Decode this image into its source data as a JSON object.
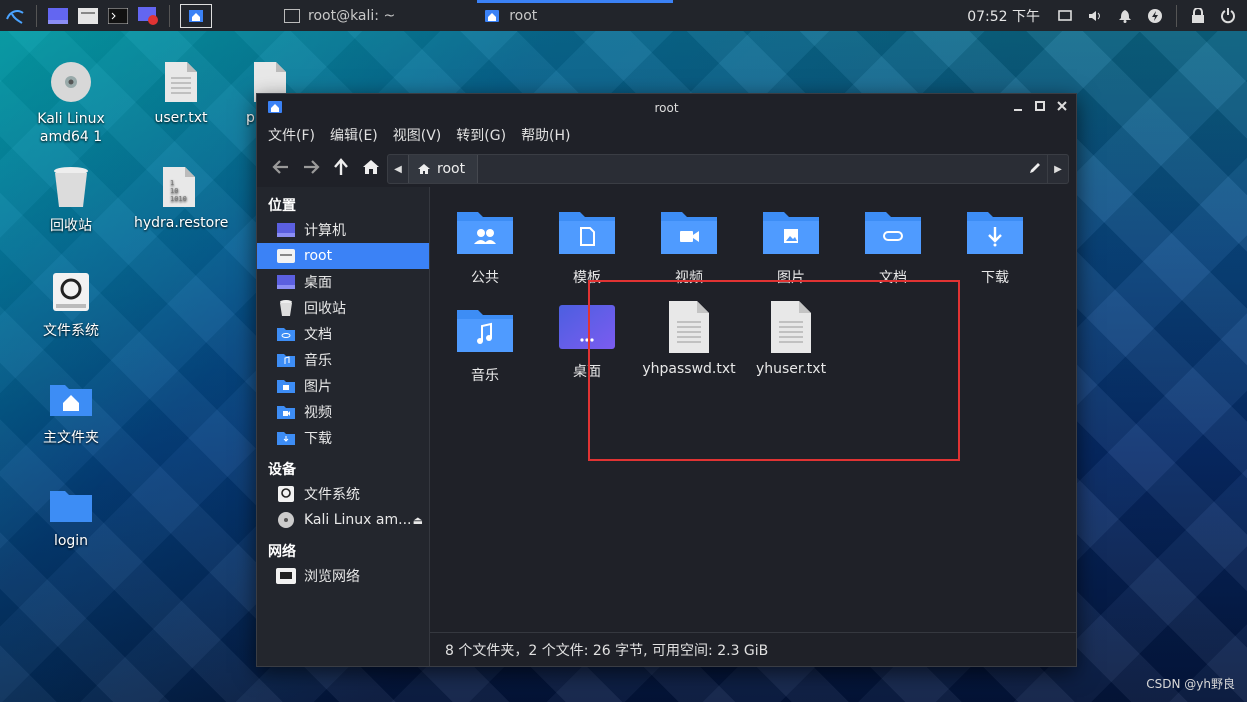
{
  "taskbar": {
    "tasks": [
      {
        "label": "root@kali: ~"
      },
      {
        "label": "root",
        "active": true
      }
    ],
    "clock": "07:52 下午"
  },
  "desktop": {
    "icons": [
      {
        "label": "Kali Linux\namd64 1",
        "icon": "disc-icon"
      },
      {
        "label": "user.txt",
        "icon": "text-file-icon"
      },
      {
        "label": "p",
        "icon": "text-file-icon"
      },
      {
        "label": "回收站",
        "icon": "trash-icon"
      },
      {
        "label": "hydra.restore",
        "icon": "binary-file-icon"
      },
      {
        "label": "文件系统",
        "icon": "drive-icon"
      },
      {
        "label": "主文件夹",
        "icon": "home-folder-icon"
      },
      {
        "label": "login",
        "icon": "folder-icon"
      }
    ]
  },
  "window": {
    "title": "root",
    "menu": [
      "文件(F)",
      "编辑(E)",
      "视图(V)",
      "转到(G)",
      "帮助(H)"
    ],
    "path": "root",
    "sidebar": {
      "places_header": "位置",
      "places": [
        "计算机",
        "root",
        "桌面",
        "回收站",
        "文档",
        "音乐",
        "图片",
        "视频",
        "下载"
      ],
      "devices_header": "设备",
      "devices": [
        "文件系统",
        "Kali Linux am..."
      ],
      "network_header": "网络",
      "network": [
        "浏览网络"
      ]
    },
    "files": [
      {
        "name": "公共",
        "icon": "public-folder-icon"
      },
      {
        "name": "模板",
        "icon": "templates-folder-icon"
      },
      {
        "name": "视频",
        "icon": "videos-folder-icon"
      },
      {
        "name": "图片",
        "icon": "pictures-folder-icon"
      },
      {
        "name": "文档",
        "icon": "documents-folder-icon"
      },
      {
        "name": "下载",
        "icon": "downloads-folder-icon"
      },
      {
        "name": "音乐",
        "icon": "music-folder-icon"
      },
      {
        "name": "桌面",
        "icon": "desktop-folder-icon"
      },
      {
        "name": "yhpasswd.txt",
        "icon": "text-file-icon"
      },
      {
        "name": "yhuser.txt",
        "icon": "text-file-icon"
      }
    ],
    "status": "8 个文件夹，2 个文件: 26 字节, 可用空间: 2.3 GiB"
  },
  "watermark": "CSDN @yh野良",
  "colors": {
    "accent": "#3b82f6",
    "highlight_box": "#e03333",
    "folder": "#3d8df5"
  }
}
